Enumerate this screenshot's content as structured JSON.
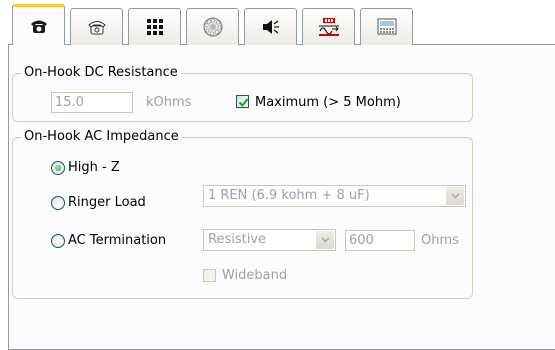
{
  "tabs": [
    {
      "icon": "telephone-icon",
      "active": true
    },
    {
      "icon": "telephone-outline-icon",
      "active": false
    },
    {
      "icon": "keypad-icon",
      "active": false
    },
    {
      "icon": "dial-icon",
      "active": false
    },
    {
      "icon": "speaker-icon",
      "active": false
    },
    {
      "icon": "signal-meter-icon",
      "active": false
    },
    {
      "icon": "display-panel-icon",
      "active": false
    }
  ],
  "dc_group": {
    "title": "On-Hook DC Resistance",
    "resistance_value": "15.0",
    "resistance_unit": "kOhms",
    "maximum_label": "Maximum (> 5 Mohm)",
    "maximum_checked": true
  },
  "ac_group": {
    "title": "On-Hook AC Impedance",
    "options": [
      {
        "label": "High - Z",
        "selected": true
      },
      {
        "label": "Ringer Load",
        "selected": false
      },
      {
        "label": "AC Termination",
        "selected": false
      }
    ],
    "ringer_load_value": "1 REN (6.9 kohm + 8 uF)",
    "termination_type": "Resistive",
    "termination_value": "600",
    "termination_unit": "Ohms",
    "wideband_label": "Wideband",
    "wideband_checked": false
  },
  "colors": {
    "active_tab_accent": "#ffc83c",
    "checkbox_check": "#21a121",
    "radio_selected": "#21a121",
    "disabled_text": "#a0a0a0"
  }
}
